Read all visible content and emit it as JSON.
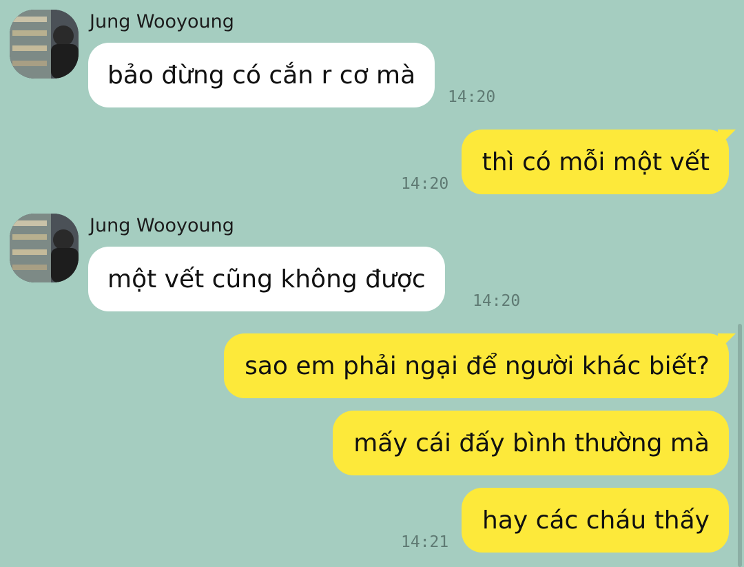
{
  "colors": {
    "background": "#a5cdc0",
    "incoming_bubble": "#ffffff",
    "outgoing_bubble": "#fde93a",
    "timestamp": "#5f7a73"
  },
  "messages": [
    {
      "direction": "incoming",
      "sender": "Jung Wooyoung",
      "avatar": "profile-photo",
      "text": "bảo đừng có cắn r cơ mà",
      "time": "14:20"
    },
    {
      "direction": "outgoing",
      "text": "thì có mỗi một vết",
      "time": "14:20"
    },
    {
      "direction": "incoming",
      "sender": "Jung Wooyoung",
      "avatar": "profile-photo",
      "text": "một vết cũng không được",
      "time": "14:20"
    },
    {
      "direction": "outgoing",
      "text": "sao em phải ngại để người khác biết?",
      "time": ""
    },
    {
      "direction": "outgoing",
      "text": "mấy cái đấy bình thường mà",
      "time": ""
    },
    {
      "direction": "outgoing",
      "text": "hay các cháu thấy",
      "time": "14:21"
    }
  ]
}
